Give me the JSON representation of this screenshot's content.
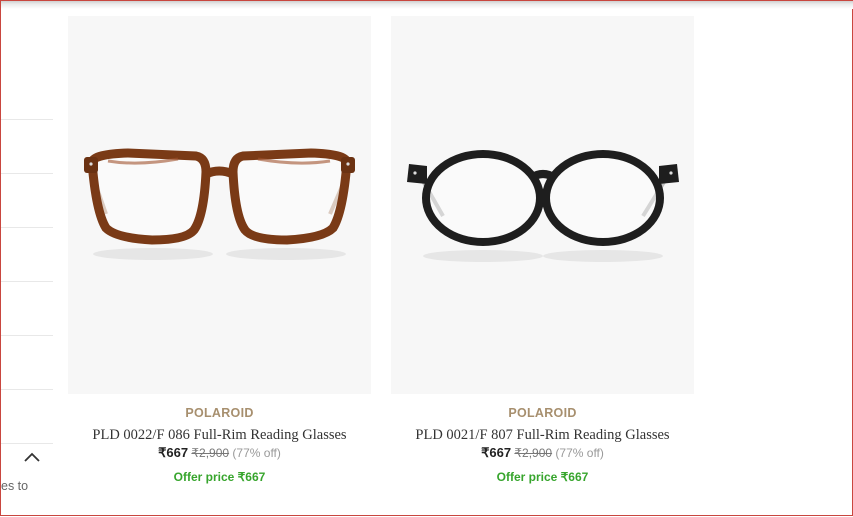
{
  "left_panel": {
    "partial_text": "es to"
  },
  "products": [
    {
      "brand": "POLAROID",
      "title": "PLD 0022/F 086 Full-Rim Reading Glasses",
      "price": "₹667",
      "mrp": "₹2,900",
      "discount": "(77% off)",
      "offer": "Offer price ₹667",
      "frame_color": "#7a3a16"
    },
    {
      "brand": "POLAROID",
      "title": "PLD 0021/F 807 Full-Rim Reading Glasses",
      "price": "₹667",
      "mrp": "₹2,900",
      "discount": "(77% off)",
      "offer": "Offer price ₹667",
      "frame_color": "#1e1e1e"
    }
  ],
  "colors": {
    "brand": "#a78f6e",
    "offer": "#37a52d",
    "card_bg": "#f7f7f7"
  }
}
